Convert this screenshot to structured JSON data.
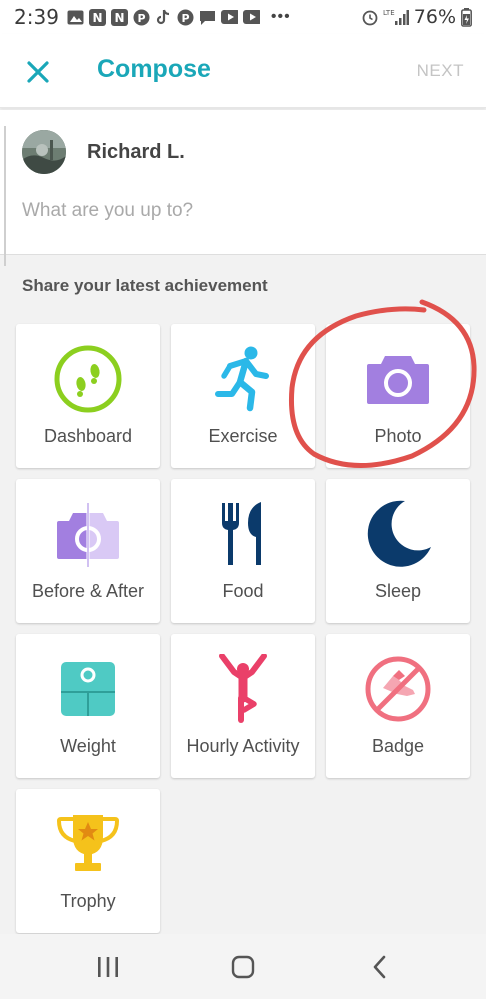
{
  "status_bar": {
    "time": "2:39",
    "battery": "76%",
    "network_label": "LTE"
  },
  "header": {
    "title": "Compose",
    "next_label": "NEXT"
  },
  "compose": {
    "user_name": "Richard L.",
    "placeholder": "What are you up to?",
    "value": ""
  },
  "section": {
    "title": "Share your latest achievement"
  },
  "tiles": [
    {
      "label": "Dashboard",
      "icon": "dashboard-icon",
      "color": "#8ccf1f"
    },
    {
      "label": "Exercise",
      "icon": "runner-icon",
      "color": "#2bb8e8"
    },
    {
      "label": "Photo",
      "icon": "camera-icon",
      "color": "#a27fe0"
    },
    {
      "label": "Before & After",
      "icon": "before-after-camera-icon",
      "color": "#a27fe0"
    },
    {
      "label": "Food",
      "icon": "fork-knife-icon",
      "color": "#0b3a6b"
    },
    {
      "label": "Sleep",
      "icon": "moon-icon",
      "color": "#0b3a6b"
    },
    {
      "label": "Weight",
      "icon": "scale-icon",
      "color": "#4fcac4"
    },
    {
      "label": "Hourly Activity",
      "icon": "person-stretch-icon",
      "color": "#ea4069"
    },
    {
      "label": "Badge",
      "icon": "badge-shoe-icon",
      "color": "#f07080"
    },
    {
      "label": "Trophy",
      "icon": "trophy-icon",
      "color": "#f5c21b"
    }
  ],
  "colors": {
    "accent": "#1aa7b8",
    "annotation": "#e0514c"
  }
}
